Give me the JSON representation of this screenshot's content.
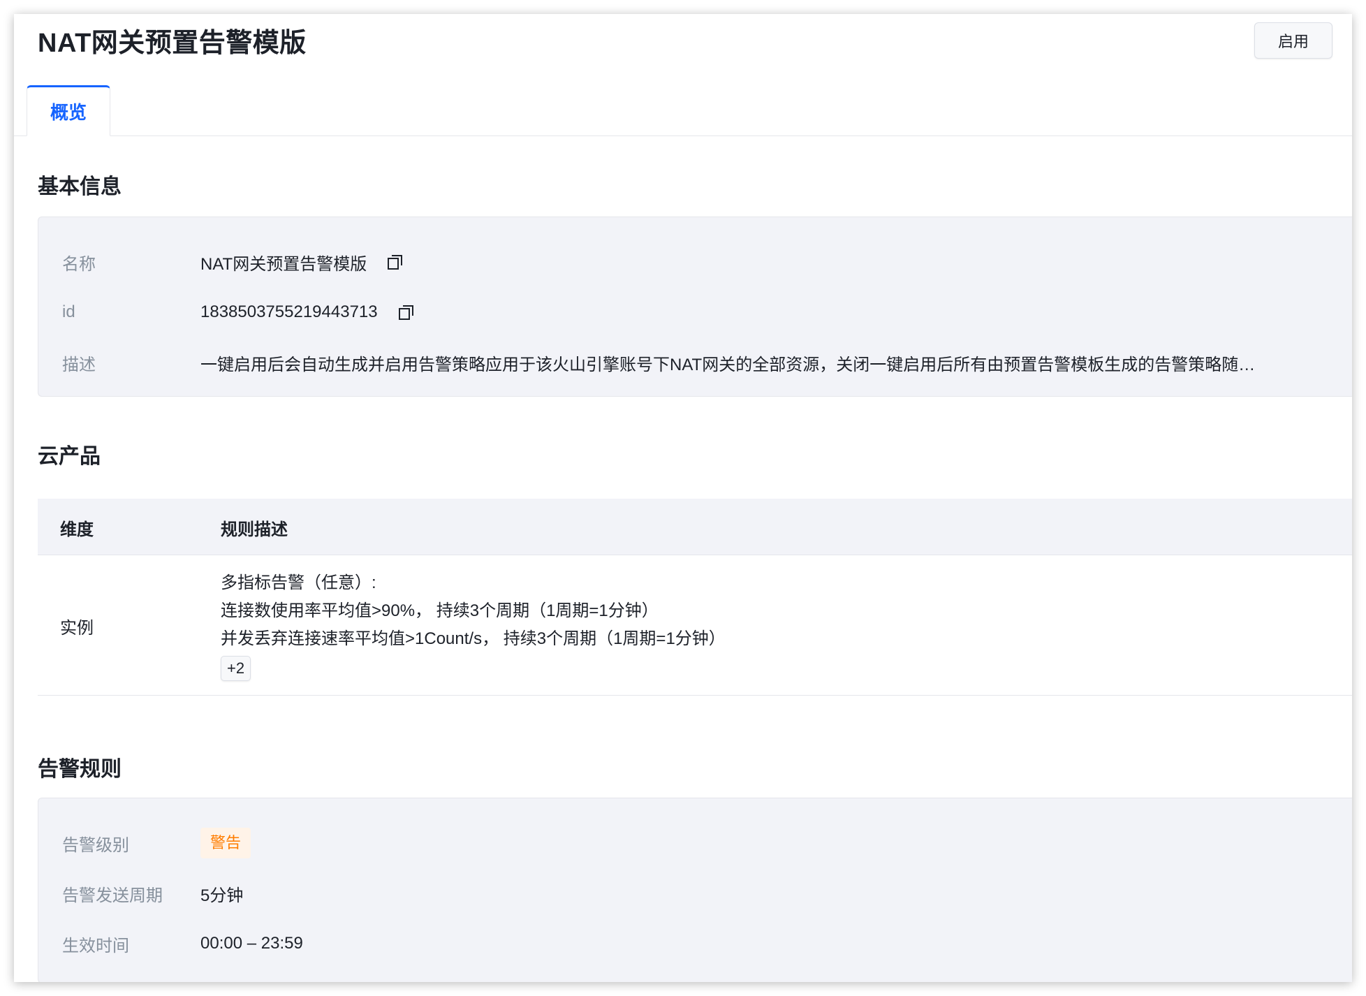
{
  "header": {
    "title": "NAT网关预置告警模版",
    "enable_label": "启用"
  },
  "tabs": [
    {
      "label": "概览",
      "active": true
    }
  ],
  "basic_info": {
    "title": "基本信息",
    "rows": [
      {
        "label": "名称",
        "value": "NAT网关预置告警模版",
        "copyable": true
      },
      {
        "label": "id",
        "value": "1838503755219443713",
        "copyable": true
      },
      {
        "label": "描述",
        "value": "一键启用后会自动生成并启用告警策略应用于该火山引擎账号下NAT网关的全部资源，关闭一键启用后所有由预置告警模板生成的告警策略随…",
        "copyable": false
      }
    ]
  },
  "cloud_product": {
    "title": "云产品",
    "columns": [
      "维度",
      "规则描述"
    ],
    "rows": [
      {
        "dimension": "实例",
        "rules": [
          "多指标告警（任意）:",
          "连接数使用率平均值>90%， 持续3个周期（1周期=1分钟）",
          "并发丢弃连接速率平均值>1Count/s， 持续3个周期（1周期=1分钟）"
        ],
        "more": "+2"
      }
    ]
  },
  "alert_rules": {
    "title": "告警规则",
    "rows": [
      {
        "label": "告警级别",
        "value": "警告",
        "tag": true
      },
      {
        "label": "告警发送周期",
        "value": "5分钟"
      },
      {
        "label": "生效时间",
        "value": "00:00 – 23:59"
      }
    ]
  },
  "colors": {
    "accent": "#1664ff",
    "warning_text": "#ff7d00",
    "warning_bg": "#fff3e8",
    "panel_bg": "#f2f3f8"
  },
  "icons": [
    "copy-icon"
  ]
}
